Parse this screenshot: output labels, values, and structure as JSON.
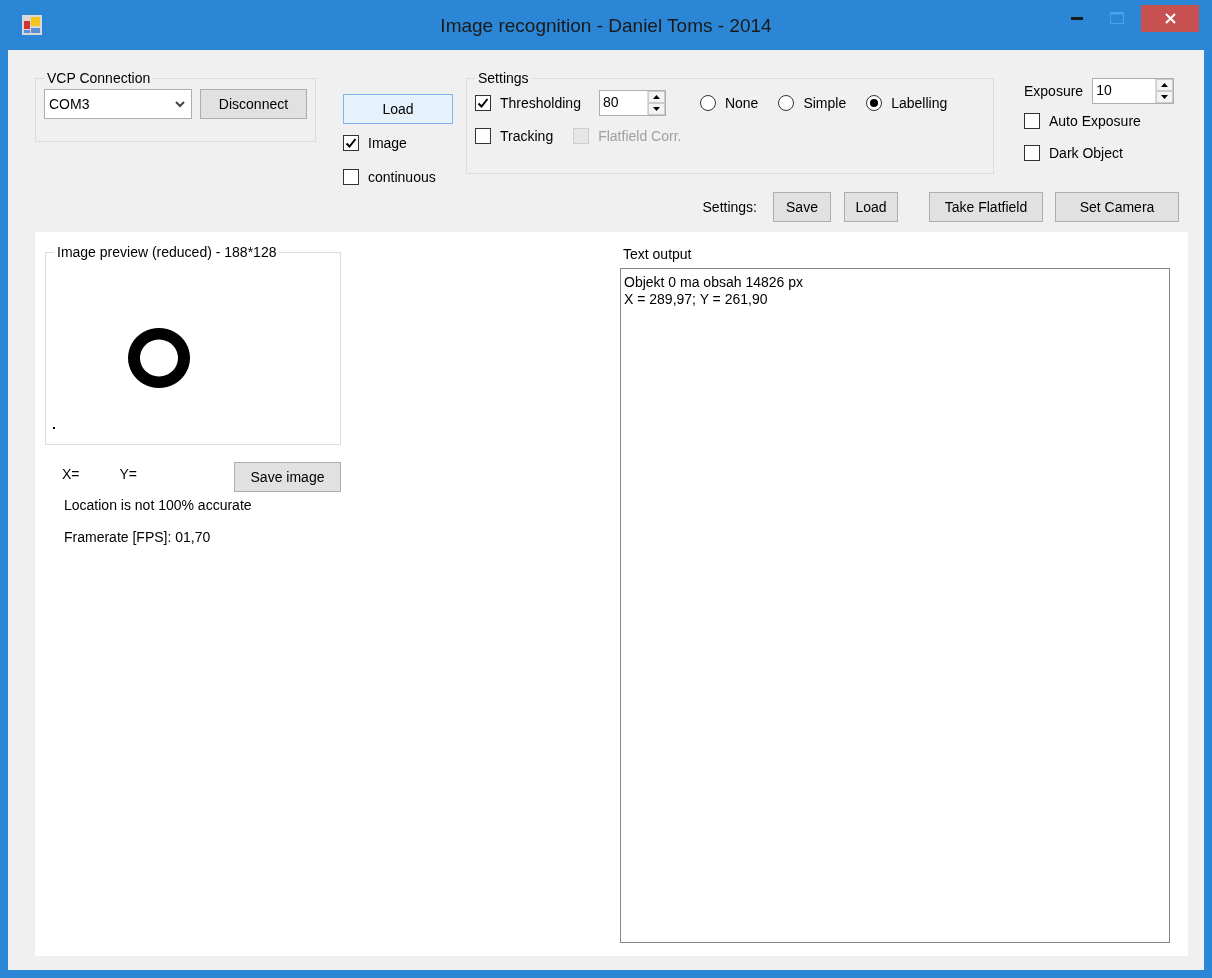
{
  "window": {
    "title": "Image recognition - Daniel Toms - 2014"
  },
  "vcp_connection": {
    "title": "VCP Connection",
    "port": "COM3",
    "button": "Disconnect"
  },
  "load_button": {
    "label": "Load",
    "focused": true
  },
  "image_checkbox": {
    "label": "Image",
    "checked": true
  },
  "continuous_checkbox": {
    "label": "continuous",
    "checked": false
  },
  "settings": {
    "title": "Settings",
    "thresholding": {
      "label": "Thresholding",
      "checked": true,
      "value": "80"
    },
    "tracking": {
      "label": "Tracking",
      "checked": false
    },
    "flatfield": {
      "label": "Flatfield Corr.",
      "checked": false,
      "disabled": true
    },
    "modes": [
      {
        "label": "None",
        "selected": false
      },
      {
        "label": "Simple",
        "selected": false
      },
      {
        "label": "Labelling",
        "selected": true
      }
    ]
  },
  "exposure": {
    "label": "Exposure",
    "value": "10"
  },
  "auto_exposure": {
    "label": "Auto Exposure",
    "checked": false
  },
  "dark_object": {
    "label": "Dark Object",
    "checked": false
  },
  "settings_file": {
    "label": "Settings:",
    "save": "Save",
    "load": "Load"
  },
  "take_flatfield": "Take Flatfield",
  "set_camera": "Set Camera",
  "preview": {
    "title": "Image preview (reduced) - 188*128",
    "x_label": "X=",
    "y_label": "Y=",
    "save_button": "Save image",
    "note": "Location is not 100% accurate",
    "framerate": "Framerate [FPS]: 01,70"
  },
  "text_output": {
    "label": "Text output",
    "lines": [
      "Objekt 0 ma obsah 14826 px",
      "X = 289,97; Y = 261,90"
    ]
  }
}
